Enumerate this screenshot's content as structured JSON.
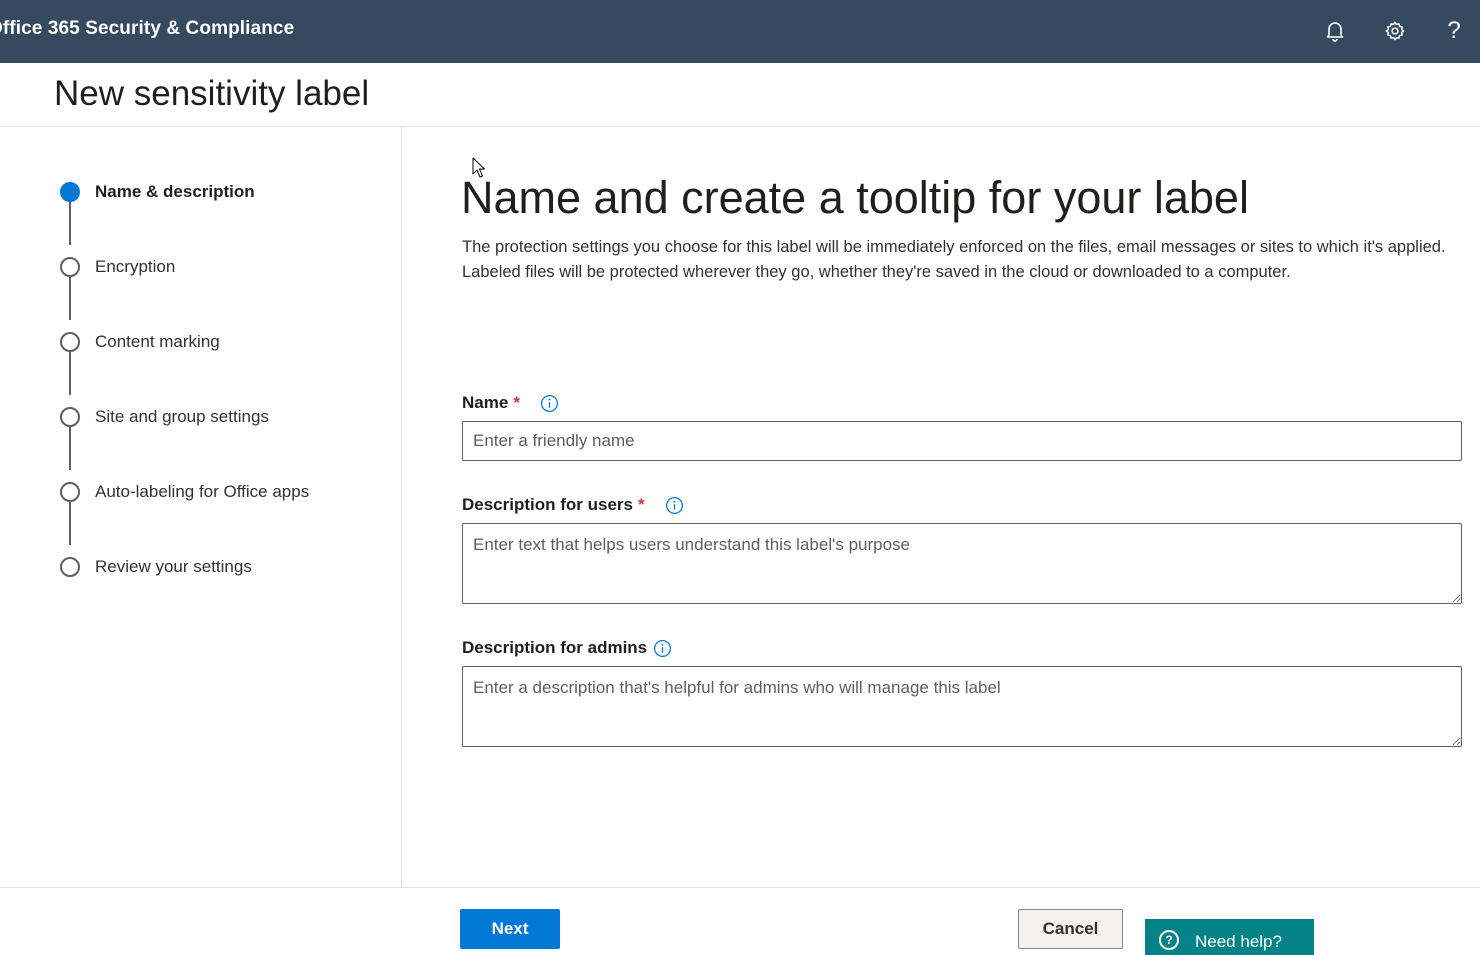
{
  "app": {
    "title": "Office 365 Security & Compliance"
  },
  "topbar": {
    "icons": [
      "bell-icon",
      "gear-icon",
      "help-icon"
    ],
    "help_glyph": "?"
  },
  "page": {
    "title": "New sensitivity label"
  },
  "steps": [
    {
      "label": "Name & description",
      "state": "active"
    },
    {
      "label": "Encryption",
      "state": "pending"
    },
    {
      "label": "Content marking",
      "state": "pending"
    },
    {
      "label": "Site and group settings",
      "state": "pending"
    },
    {
      "label": "Auto-labeling for Office apps",
      "state": "pending"
    },
    {
      "label": "Review your settings",
      "state": "pending"
    }
  ],
  "main": {
    "heading": "Name and create a tooltip for your label",
    "intro": "The protection settings you choose for this label will be immediately enforced on the files, email messages or sites to which it's applied. Labeled files will be protected wherever they go, whether they're saved in the cloud or downloaded to a computer.",
    "name_field": {
      "label": "Name",
      "required_mark": "*",
      "placeholder": "Enter a friendly name",
      "value": ""
    },
    "users_desc_field": {
      "label": "Description for users",
      "required_mark": "*",
      "placeholder": "Enter text that helps users understand this label's purpose",
      "value": ""
    },
    "admins_desc_field": {
      "label": "Description for admins",
      "placeholder": "Enter a description that's helpful for admins who will manage this label",
      "value": ""
    }
  },
  "footer": {
    "next_label": "Next",
    "cancel_label": "Cancel",
    "help_label": "Need help?",
    "help_glyph": "?"
  },
  "colors": {
    "topbar": "#364a5f",
    "accent": "#0078d4",
    "required": "#d13438",
    "help_button": "#038387"
  }
}
